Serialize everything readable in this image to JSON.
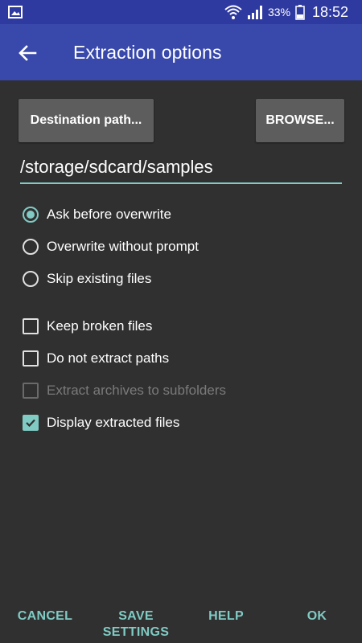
{
  "status_bar": {
    "battery_percent": "33%",
    "time": "18:52"
  },
  "app_bar": {
    "title": "Extraction options"
  },
  "destination_button": {
    "label": "Destination path..."
  },
  "browse_button": {
    "label": "BROWSE..."
  },
  "path_field": {
    "value": "/storage/sdcard/samples"
  },
  "overwrite_options": [
    {
      "label": "Ask before overwrite",
      "checked": true
    },
    {
      "label": "Overwrite without prompt",
      "checked": false
    },
    {
      "label": "Skip existing files",
      "checked": false
    }
  ],
  "checkbox_options": [
    {
      "label": "Keep broken files",
      "checked": false,
      "enabled": true
    },
    {
      "label": "Do not extract paths",
      "checked": false,
      "enabled": true
    },
    {
      "label": "Extract archives to subfolders",
      "checked": false,
      "enabled": false
    },
    {
      "label": "Display extracted files",
      "checked": true,
      "enabled": true
    }
  ],
  "actions": {
    "cancel": "CANCEL",
    "save_line1": "SAVE",
    "save_line2": "SETTINGS",
    "help": "HELP",
    "ok": "OK"
  },
  "colors": {
    "accent": "#80cbc4",
    "app_bar": "#3949ab",
    "status_bar": "#2f3aa0",
    "background": "#303030"
  },
  "icons": {
    "status_left": "image-icon",
    "wifi": "wifi-icon",
    "signal": "signal-icon",
    "battery": "battery-icon",
    "back": "arrow-left-icon"
  }
}
